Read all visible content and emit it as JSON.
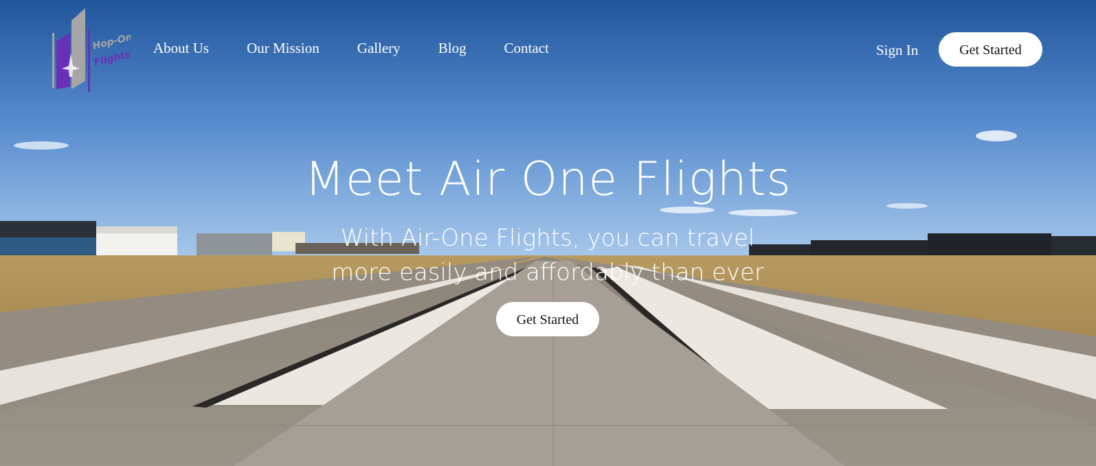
{
  "brand": {
    "logo_text_line1": "Hop-On",
    "logo_text_line2": "Flights",
    "colors": {
      "purple": "#6a2fb8",
      "gray": "#a6a6a6"
    }
  },
  "nav": {
    "items": [
      {
        "label": "About Us"
      },
      {
        "label": "Our Mission"
      },
      {
        "label": "Gallery"
      },
      {
        "label": "Blog"
      },
      {
        "label": "Contact"
      }
    ],
    "sign_in": "Sign In",
    "cta": "Get Started"
  },
  "hero": {
    "title": "Meet Air One Flights",
    "subtitle": "With Air-One Flights, you can travel more easily and affordably than ever",
    "cta": "Get Started",
    "background_icon": "runway-photo"
  }
}
